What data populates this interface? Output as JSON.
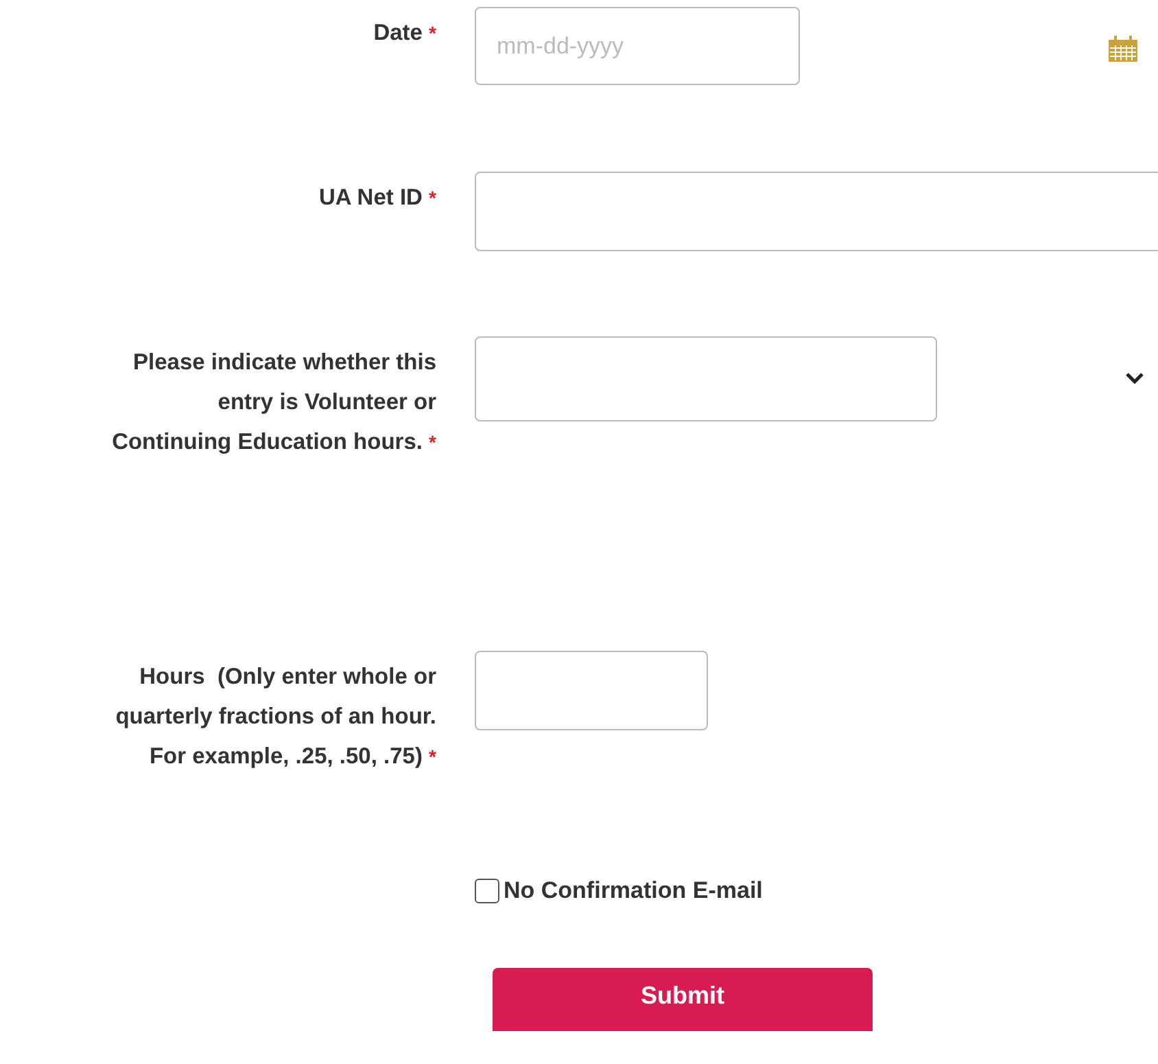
{
  "fields": [
    {
      "kind": "date",
      "label": "Date",
      "required_mark": "*",
      "placeholder": "mm-dd-yyyy"
    },
    {
      "kind": "text",
      "label": "UA Net ID",
      "required_mark": "*"
    },
    {
      "kind": "select",
      "label": "Please indicate whether this entry is Volunteer or Continuing Education hours.",
      "required_mark": "*"
    },
    {
      "kind": "number",
      "label": "Hours  (Only enter whole or quarterly fractions of an hour. For example, .25, .50, .75)",
      "required_mark": "*"
    }
  ],
  "confirmation": {
    "label": "No Confirmation E-mail",
    "checked": false
  },
  "submit": {
    "label": "Submit"
  }
}
